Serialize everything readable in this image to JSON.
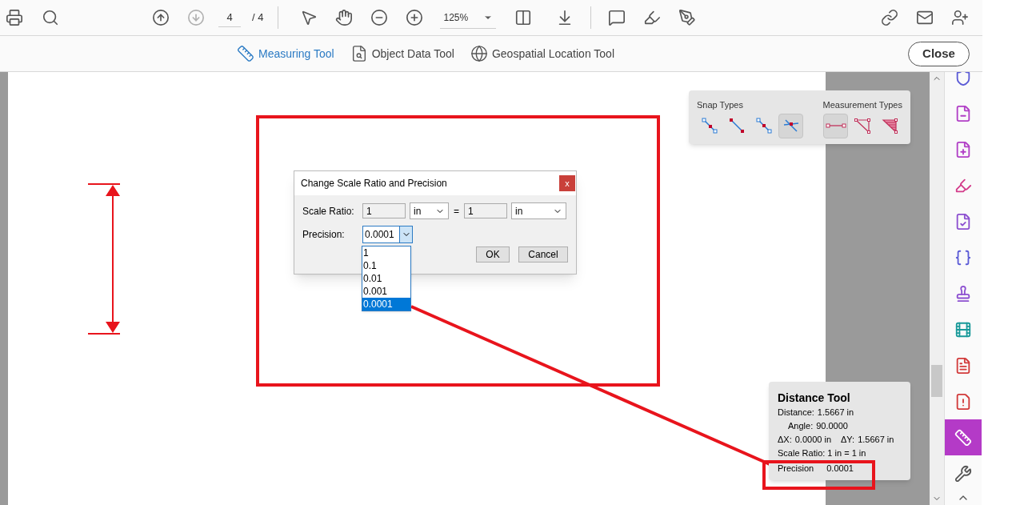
{
  "toolbar": {
    "page_current": "4",
    "page_total": "/ 4",
    "zoom": "125%"
  },
  "tool_tabs": [
    {
      "label": "Measuring Tool",
      "selected": true,
      "kind": "ruler"
    },
    {
      "label": "Object Data Tool",
      "selected": false,
      "kind": "object"
    },
    {
      "label": "Geospatial Location Tool",
      "selected": false,
      "kind": "globe"
    }
  ],
  "close_button": "Close",
  "snap_panel": {
    "snap_title": "Snap Types",
    "measure_title": "Measurement Types",
    "snap_types": [
      {
        "kind": "endpoint",
        "selected": false
      },
      {
        "kind": "midline",
        "selected": false
      },
      {
        "kind": "midpoint",
        "selected": false
      },
      {
        "kind": "intersection",
        "selected": true
      }
    ],
    "measurement_types": [
      {
        "kind": "distance",
        "selected": true
      },
      {
        "kind": "perimeter",
        "selected": false
      },
      {
        "kind": "area",
        "selected": false
      }
    ]
  },
  "dialog": {
    "title": "Change Scale Ratio and Precision",
    "close": "x",
    "scale_label": "Scale Ratio:",
    "scale_from": "1",
    "unit_from": "in",
    "equals": "=",
    "scale_to": "1",
    "unit_to": "in",
    "precision_label": "Precision:",
    "precision_value": "0.0001",
    "precision_options": [
      {
        "label": "1",
        "selected": false
      },
      {
        "label": "0.1",
        "selected": false
      },
      {
        "label": "0.01",
        "selected": false
      },
      {
        "label": "0.001",
        "selected": false
      },
      {
        "label": "0.0001",
        "selected": true
      }
    ],
    "ok": "OK",
    "cancel": "Cancel"
  },
  "distance_panel": {
    "title": "Distance Tool",
    "distance_label": "Distance:",
    "distance": "1.5667 in",
    "angle_label": "Angle:",
    "angle": "90.0000",
    "dx_label": "ΔX:",
    "dx": "0.0000 in",
    "dy_label": "ΔY:",
    "dy": "1.5667 in",
    "scale_ratio": "Scale Ratio: 1 in = 1 in",
    "precision_label": "Precision",
    "precision": "0.0001"
  },
  "sidebar": {
    "items": [
      {
        "kind": "protect",
        "selected": false
      },
      {
        "kind": "form",
        "selected": false
      },
      {
        "kind": "prepare",
        "selected": false
      },
      {
        "kind": "sign",
        "selected": false
      },
      {
        "kind": "certificate",
        "selected": false
      },
      {
        "kind": "javascript",
        "selected": false
      },
      {
        "kind": "stamp",
        "selected": false
      },
      {
        "kind": "media",
        "selected": false
      },
      {
        "kind": "pdf",
        "selected": false
      },
      {
        "kind": "info",
        "selected": false
      },
      {
        "kind": "measure",
        "selected": true
      },
      {
        "kind": "tools",
        "selected": false
      }
    ]
  }
}
